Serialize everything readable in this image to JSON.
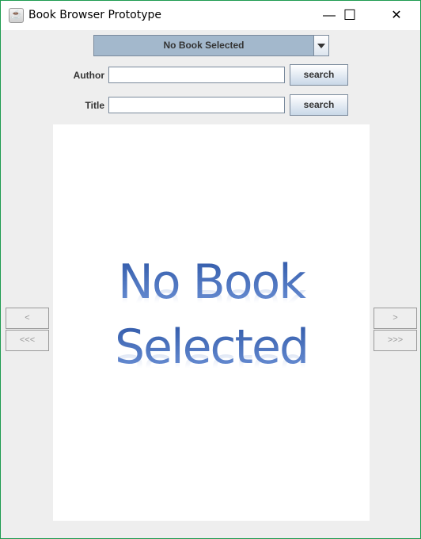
{
  "window": {
    "title": "Book Browser Prototype",
    "minimize": "—",
    "maximize": "☐",
    "close": "✕"
  },
  "book_select": {
    "selected": "No Book Selected"
  },
  "author": {
    "label": "Author",
    "value": "",
    "button": "search"
  },
  "title_search": {
    "label": "Title",
    "value": "",
    "button": "search"
  },
  "cover": {
    "line1": "No Book",
    "line2": "Selected"
  },
  "nav": {
    "prev": "<",
    "first": "<<<",
    "next": ">",
    "last": ">>>"
  }
}
